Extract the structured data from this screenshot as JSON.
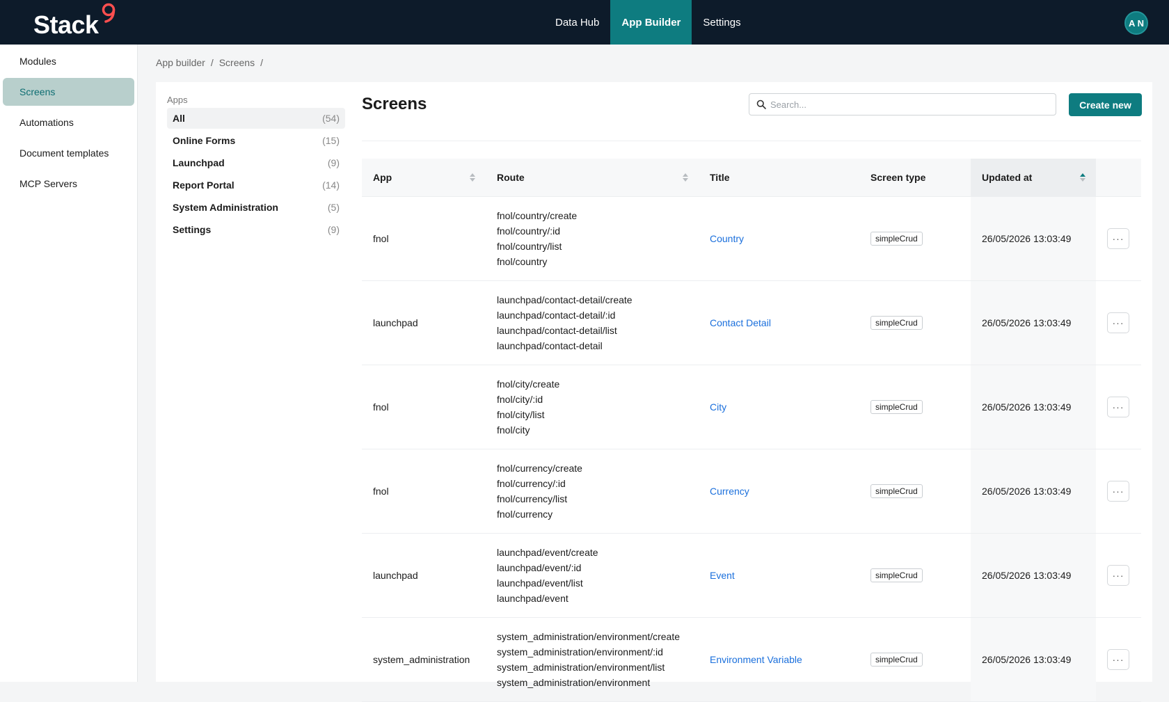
{
  "brand": {
    "name": "Stack",
    "mark": "9"
  },
  "nav": [
    {
      "label": "Data Hub",
      "active": false
    },
    {
      "label": "App Builder",
      "active": true
    },
    {
      "label": "Settings",
      "active": false
    }
  ],
  "user": {
    "initials": "A N"
  },
  "sidebar": {
    "items": [
      {
        "label": "Modules",
        "active": false
      },
      {
        "label": "Screens",
        "active": true
      },
      {
        "label": "Automations",
        "active": false
      },
      {
        "label": "Document templates",
        "active": false
      },
      {
        "label": "MCP Servers",
        "active": false
      }
    ]
  },
  "breadcrumb": {
    "part1": "App builder",
    "sep1": "/",
    "part2": "Screens",
    "sep2": "/"
  },
  "apps": {
    "title": "Apps",
    "items": [
      {
        "label": "All",
        "count": "(54)"
      },
      {
        "label": "Online Forms",
        "count": "(15)"
      },
      {
        "label": "Launchpad",
        "count": "(9)"
      },
      {
        "label": "Report Portal",
        "count": "(14)"
      },
      {
        "label": "System Administration",
        "count": "(5)"
      },
      {
        "label": "Settings",
        "count": "(9)"
      }
    ]
  },
  "main": {
    "title": "Screens",
    "search_placeholder": "Search...",
    "create_label": "Create new"
  },
  "table": {
    "headers": {
      "app": "App",
      "route": "Route",
      "title": "Title",
      "type": "Screen type",
      "updated": "Updated at"
    },
    "rows": [
      {
        "app": "fnol",
        "routes": [
          "fnol/country/create",
          "fnol/country/:id",
          "fnol/country/list",
          "fnol/country"
        ],
        "title": "Country",
        "type": "simpleCrud",
        "updated": "26/05/2026 13:03:49"
      },
      {
        "app": "launchpad",
        "routes": [
          "launchpad/contact-detail/create",
          "launchpad/contact-detail/:id",
          "launchpad/contact-detail/list",
          "launchpad/contact-detail"
        ],
        "title": "Contact Detail",
        "type": "simpleCrud",
        "updated": "26/05/2026 13:03:49"
      },
      {
        "app": "fnol",
        "routes": [
          "fnol/city/create",
          "fnol/city/:id",
          "fnol/city/list",
          "fnol/city"
        ],
        "title": "City",
        "type": "simpleCrud",
        "updated": "26/05/2026 13:03:49"
      },
      {
        "app": "fnol",
        "routes": [
          "fnol/currency/create",
          "fnol/currency/:id",
          "fnol/currency/list",
          "fnol/currency"
        ],
        "title": "Currency",
        "type": "simpleCrud",
        "updated": "26/05/2026 13:03:49"
      },
      {
        "app": "launchpad",
        "routes": [
          "launchpad/event/create",
          "launchpad/event/:id",
          "launchpad/event/list",
          "launchpad/event"
        ],
        "title": "Event",
        "type": "simpleCrud",
        "updated": "26/05/2026 13:03:49"
      },
      {
        "app": "system_administration",
        "routes": [
          "system_administration/environment/create",
          "system_administration/environment/:id",
          "system_administration/environment/list",
          "system_administration/environment"
        ],
        "title": "Environment Variable",
        "type": "simpleCrud",
        "updated": "26/05/2026 13:03:49"
      }
    ],
    "more_label": "···"
  },
  "colors": {
    "topbar": "#0d1b2a",
    "accent": "#0e7c80",
    "link": "#1a6fdc",
    "logo_mark": "#ff4f4f"
  }
}
